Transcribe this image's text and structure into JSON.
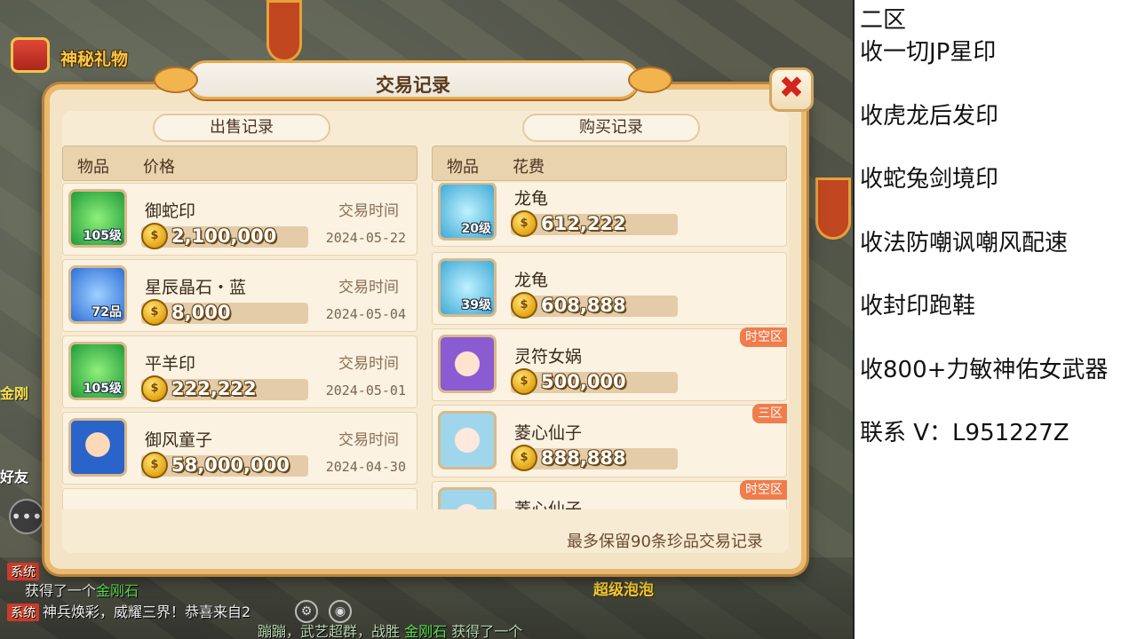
{
  "hud": {
    "gift_label": "神秘礼物",
    "side_text_1": "金刚",
    "side_text_2": "好友"
  },
  "dialog": {
    "title": "交易记录",
    "close_label": "✖",
    "footer_note": "最多保留90条珍品交易记录"
  },
  "sell": {
    "tab_label": "出售记录",
    "col_item": "物品",
    "col_price": "价格",
    "rows": [
      {
        "name": "御蛇印",
        "level": "105级",
        "price": "2,100,000",
        "time_label": "交易时间",
        "time": "2024-05-22",
        "icon": "snake-seal-icon"
      },
      {
        "name": "星辰晶石・蓝",
        "level": "72品",
        "price": "8,000",
        "time_label": "交易时间",
        "time": "2024-05-04",
        "icon": "blue-crystal-icon"
      },
      {
        "name": "平羊印",
        "level": "105级",
        "price": "222,222",
        "time_label": "交易时间",
        "time": "2024-05-01",
        "icon": "sheep-seal-icon"
      },
      {
        "name": "御风童子",
        "level": "",
        "price": "58,000,000",
        "time_label": "交易时间",
        "time": "2024-04-30",
        "icon": "wind-boy-icon"
      }
    ]
  },
  "buy": {
    "tab_label": "购买记录",
    "col_item": "物品",
    "col_cost": "花费",
    "rows": [
      {
        "name": "龙龟",
        "level": "20级",
        "price": "612,222",
        "badge": "",
        "icon": "dragon-turtle-icon"
      },
      {
        "name": "龙龟",
        "level": "39级",
        "price": "608,888",
        "badge": "",
        "icon": "dragon-turtle-icon"
      },
      {
        "name": "灵符女娲",
        "level": "",
        "price": "500,000",
        "badge": "时空区",
        "icon": "nuwa-icon"
      },
      {
        "name": "菱心仙子",
        "level": "",
        "price": "888,888",
        "badge": "三区",
        "icon": "fairy-icon"
      },
      {
        "name": "菱心仙子",
        "level": "",
        "price": "",
        "badge": "时空区",
        "icon": "fairy-icon"
      }
    ]
  },
  "chat": {
    "line1_prefix": "系统",
    "line1_text": "获得了一个",
    "line1_item": "金刚石",
    "line2_prefix": "系统",
    "line2_text": "神兵焕彩，威耀三界！恭喜来自2",
    "line3_text": "蹦蹦，武艺超群，战胜",
    "line3_item": "金刚石",
    "line3_mid": "获得了一个",
    "bubble_text": "超级泡泡"
  },
  "side_panel": {
    "lines": [
      "二区",
      "收一切JP星印",
      "收虎龙后发印",
      "收蛇兔剑境印",
      "收法防嘲讽嘲风配速",
      "收封印跑鞋",
      "收800+力敏神佑女武器",
      "联系 V：L951227Z"
    ]
  },
  "colors": {
    "dialog_bg": "#f4e4c6",
    "dialog_border": "#e9b96e",
    "close_x": "#d3261e",
    "price_text": "#ffffff",
    "region_badge": "#f07d4c"
  }
}
